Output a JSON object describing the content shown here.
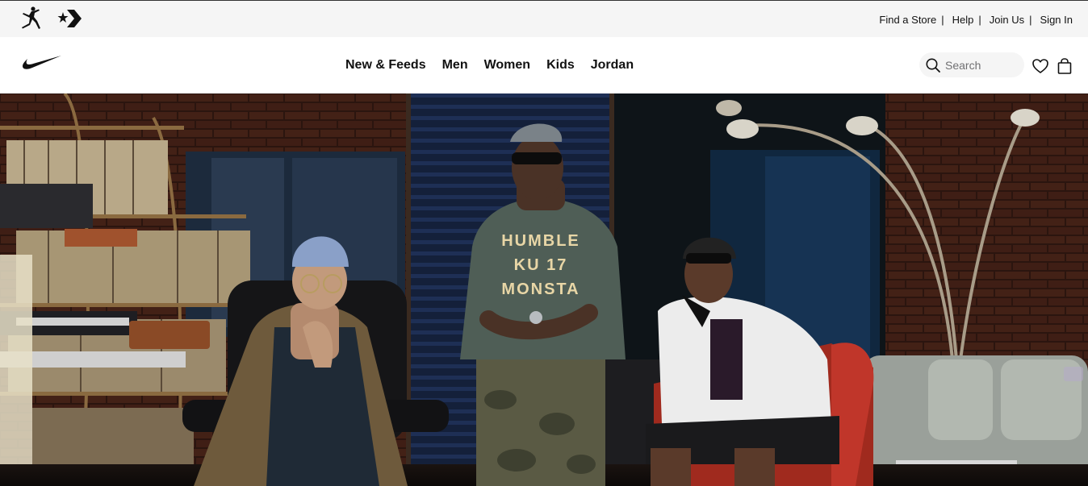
{
  "utility_bar": {
    "brand_icons": [
      "jordan-jumpman-icon",
      "converse-star-chevron-icon"
    ],
    "links": [
      {
        "label": "Find a Store"
      },
      {
        "label": "Help"
      },
      {
        "label": "Join Us"
      },
      {
        "label": "Sign In"
      }
    ],
    "separator": "|"
  },
  "main_nav": {
    "logo": "nike-swoosh-icon",
    "items": [
      {
        "label": "New & Feeds"
      },
      {
        "label": "Men"
      },
      {
        "label": "Women"
      },
      {
        "label": "Kids"
      },
      {
        "label": "Jordan"
      }
    ],
    "search": {
      "placeholder": "Search",
      "value": ""
    },
    "icons": [
      "search-icon",
      "heart-icon",
      "bag-icon"
    ]
  },
  "hero": {
    "hoodie_lines": [
      "HUMBLE",
      "KU 17",
      "MONSTA"
    ]
  },
  "colors": {
    "utility_bg": "#f5f5f5",
    "nav_text": "#111111",
    "search_bg": "#f5f5f5",
    "hero_bg": "#1a110d"
  }
}
